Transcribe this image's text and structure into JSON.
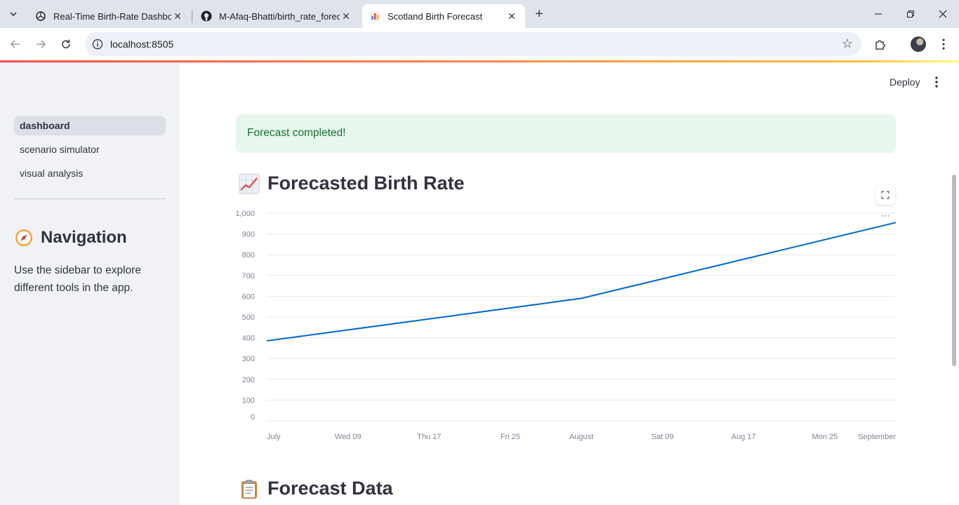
{
  "browser": {
    "tabs": [
      {
        "title": "Real-Time Birth-Rate Dashboard",
        "icon": "openai-icon"
      },
      {
        "title": "M-Afaq-Bhatti/birth_rate_forecast",
        "icon": "github-icon"
      },
      {
        "title": "Scotland Birth Forecast",
        "icon": "chart-favicon-icon",
        "active": true
      }
    ],
    "url": "localhost:8505"
  },
  "header": {
    "deploy_label": "Deploy"
  },
  "sidebar": {
    "items": [
      {
        "label": "dashboard",
        "active": true
      },
      {
        "label": "scenario simulator"
      },
      {
        "label": "visual analysis"
      }
    ],
    "title": "Navigation",
    "text": "Use the sidebar to explore different tools in the app."
  },
  "main": {
    "alert": "Forecast completed!",
    "chart_heading": "Forecasted Birth Rate",
    "data_heading": "Forecast Data"
  },
  "colors": {
    "line": "#0068c9",
    "success_bg": "#e8f7ec",
    "success_text": "#177233",
    "sidebar_bg": "#f0f2f6"
  },
  "chart_data": {
    "type": "line",
    "x": [
      "2025-07-01",
      "2025-08-01",
      "2025-09-01"
    ],
    "series": [
      {
        "values": [
          385,
          590,
          955
        ]
      }
    ],
    "x_ticks": [
      "July",
      "Wed 09",
      "Thu 17",
      "Fri 25",
      "August",
      "Sat 09",
      "Aug 17",
      "Mon 25",
      "September"
    ],
    "y_ticks": [
      "1,000",
      "900",
      "800",
      "700",
      "600",
      "500",
      "400",
      "300",
      "200",
      "100",
      "0"
    ],
    "ylim": [
      0,
      1000
    ],
    "grid": true,
    "title": "",
    "xlabel": "",
    "ylabel": ""
  }
}
